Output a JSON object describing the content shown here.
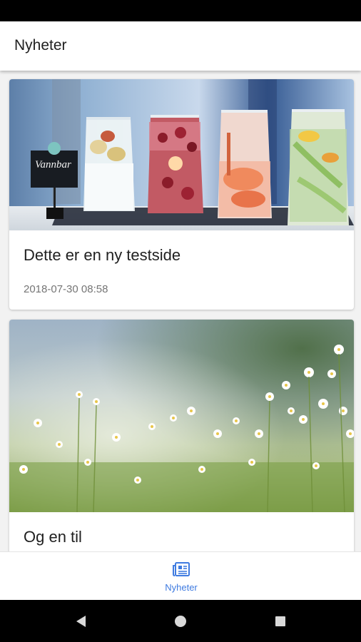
{
  "app": {
    "title": "Nyheter"
  },
  "articles": [
    {
      "title": "Dette er en ny testside",
      "date": "2018-07-30 08:58",
      "sign_text": "Vannbar"
    },
    {
      "title": "Og en til"
    }
  ],
  "bottom_nav": {
    "items": [
      {
        "label": "Nyheter",
        "icon": "newspaper-icon",
        "active": true
      }
    ]
  },
  "system_nav": {
    "buttons": [
      "back-icon",
      "home-icon",
      "recents-icon"
    ]
  },
  "colors": {
    "accent": "#3f7be0",
    "background": "#f2f2f2",
    "status_bar": "#000000"
  }
}
